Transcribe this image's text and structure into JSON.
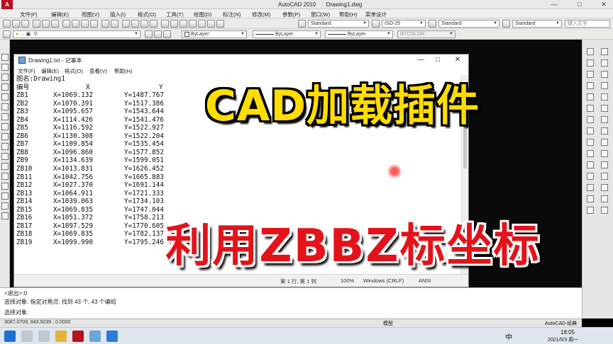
{
  "app": {
    "title": "AutoCAD 2010",
    "document": "Drawing1.dwg",
    "window_controls": [
      "—",
      "□",
      "✕"
    ]
  },
  "menu": {
    "items": [
      "文件(F)",
      "编辑(E)",
      "视图(V)",
      "插入(I)",
      "格式(O)",
      "工具(T)",
      "绘图(D)",
      "标注(N)",
      "修改(M)",
      "参数(P)",
      "窗口(W)",
      "帮助(H)",
      "菜单设计"
    ]
  },
  "toolbar": {
    "layer_value": "0",
    "text_style": "Standard",
    "dim_style": "ISO-25",
    "table_style": "Standard",
    "multileader_style": "Standard",
    "color": "ByLayer",
    "linetype": "ByLayer",
    "lineweight": "ByLayer",
    "plot_style": "BYCOLOR",
    "search_placeholder": "键入文字"
  },
  "notepad": {
    "title": "Drawing1.txt - 记事本",
    "menu": [
      "文件(F)",
      "编辑(E)",
      "格式(O)",
      "查看(V)",
      "帮助(H)"
    ],
    "window_controls": [
      "—",
      "□",
      "✕"
    ],
    "header_line": "图名:Drawing1",
    "columns": [
      "编号",
      "X",
      "Y"
    ],
    "rows": [
      [
        "ZB1",
        "X=1069.132",
        "Y=1487.767"
      ],
      [
        "ZB2",
        "X=1070.391",
        "Y=1517.386"
      ],
      [
        "ZB3",
        "X=1095.657",
        "Y=1543.644"
      ],
      [
        "ZB4",
        "X=1114.426",
        "Y=1541.476"
      ],
      [
        "ZB5",
        "X=1116.592",
        "Y=1522.927"
      ],
      [
        "ZB6",
        "X=1130.308",
        "Y=1522.204"
      ],
      [
        "ZB7",
        "X=1109.854",
        "Y=1535.454"
      ],
      [
        "ZB8",
        "X=1096.860",
        "Y=1577.852"
      ],
      [
        "ZB9",
        "X=1134.639",
        "Y=1599.051"
      ],
      [
        "ZB10",
        "X=1013.831",
        "Y=1626.452"
      ],
      [
        "ZB11",
        "X=1042.756",
        "Y=1665.883"
      ],
      [
        "ZB12",
        "X=1027.370",
        "Y=1691.144"
      ],
      [
        "ZB13",
        "X=1064.911",
        "Y=1721.333"
      ],
      [
        "ZB14",
        "X=1039.063",
        "Y=1734.103"
      ],
      [
        "ZB15",
        "X=1069.835",
        "Y=1747.044"
      ],
      [
        "ZB16",
        "X=1051.372",
        "Y=1758.213"
      ],
      [
        "ZB17",
        "X=1097.529",
        "Y=1770.605"
      ],
      [
        "ZB18",
        "X=1069.835",
        "Y=1782.137"
      ],
      [
        "ZB19",
        "X=1099.990",
        "Y=1795.246"
      ]
    ],
    "status": {
      "position": "第 1 行, 第 1 列",
      "zoom": "100%",
      "line_ending": "Windows (CRLF)",
      "encoding": "ANSI"
    }
  },
  "command": {
    "lines": [
      "<退出>:0",
      "选择对象: 指定对角点: 找到 43 个, 43 个编组",
      "选择对象:"
    ]
  },
  "statusbar": {
    "coords": "3087.0709, 843.9239 , 0.0000",
    "model": "模型",
    "workspace": "AutoCAD 经典"
  },
  "taskbar": {
    "ime": "中",
    "time": "18:05",
    "date": "2021/5/3 周一"
  },
  "overlay": {
    "headline": "CAD加载插件",
    "subline": "利用ZBBZ标坐标",
    "headline_color": "#ffdd00",
    "subline_color": "#e4121a"
  },
  "icons": [
    "autocad-logo-icon",
    "notepad-icon",
    "scroll-thumb-icon",
    "cursor-highlight-icon",
    "windows-start-icon",
    "search-icon",
    "task-view-icon",
    "file-explorer-icon",
    "edge-icon",
    "autocad-task-icon",
    "notepad-task-icon"
  ]
}
